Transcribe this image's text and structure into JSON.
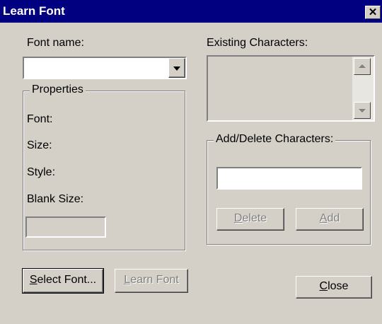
{
  "window": {
    "title": "Learn Font",
    "close_glyph": "✕"
  },
  "font_name": {
    "label": "Font name:",
    "value": ""
  },
  "properties": {
    "group_label": "Properties",
    "font_label": "Font:",
    "size_label": "Size:",
    "style_label": "Style:",
    "blank_size_label": "Blank Size:",
    "blank_size_value": ""
  },
  "existing": {
    "label": "Existing Characters:"
  },
  "add_delete": {
    "group_label": "Add/Delete Characters:",
    "value": "",
    "delete_label": "Delete",
    "add_label": "Add"
  },
  "buttons": {
    "select_font": "Select Font...",
    "learn_font": "Learn Font",
    "close": "Close"
  }
}
